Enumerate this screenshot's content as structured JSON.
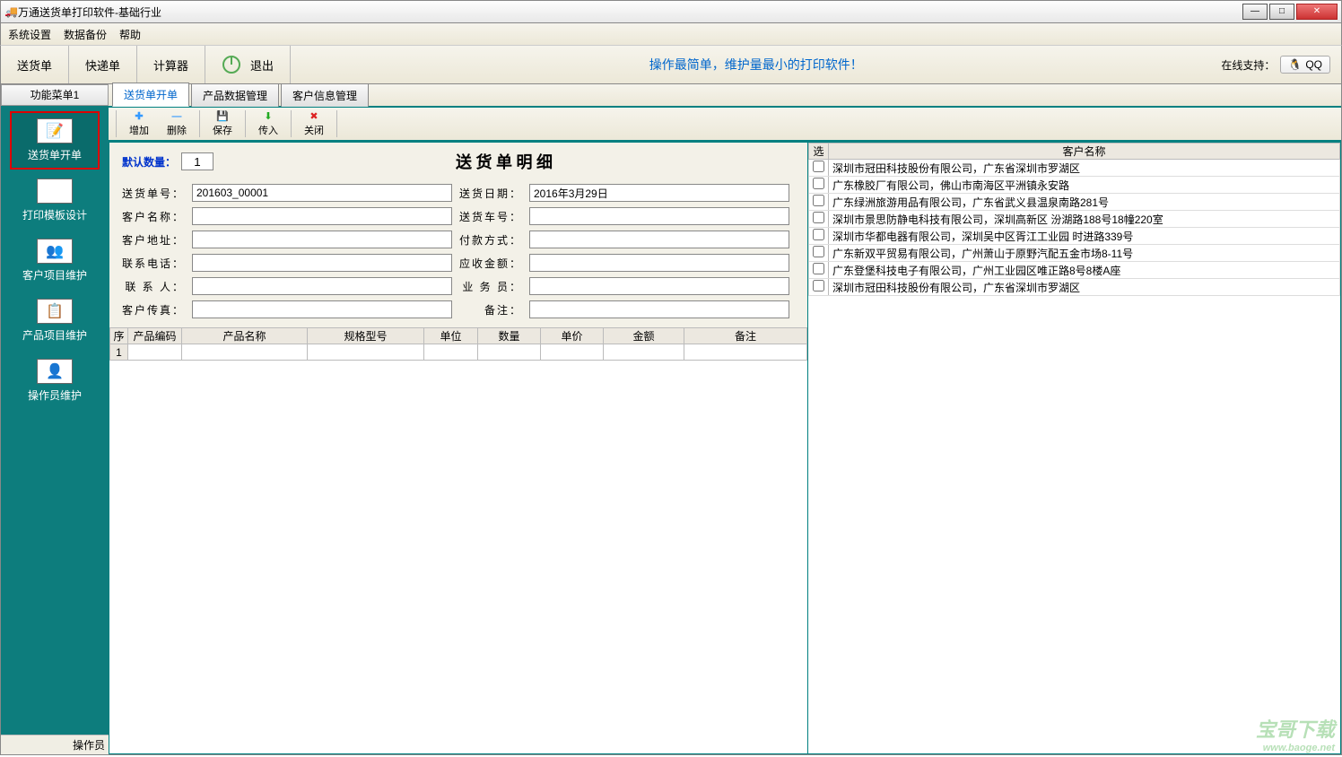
{
  "window": {
    "title": "万通送货单打印软件-基础行业"
  },
  "menubar": {
    "items": [
      "系统设置",
      "数据备份",
      "帮助"
    ]
  },
  "toolbar1": {
    "delivery": "送货单",
    "express": "快递单",
    "calc": "计算器",
    "exit": "退出",
    "slogan": "操作最简单，维护量最小的打印软件！",
    "support_label": "在线支持：",
    "qq": "QQ"
  },
  "sidebar": {
    "tab": "功能菜单1",
    "items": [
      {
        "label": "送货单开单",
        "icon": "📝"
      },
      {
        "label": "打印模板设计",
        "icon": "🖨"
      },
      {
        "label": "客户项目维护",
        "icon": "👥"
      },
      {
        "label": "产品项目维护",
        "icon": "📋"
      },
      {
        "label": "操作员维护",
        "icon": "👤"
      }
    ],
    "status": "操作员"
  },
  "tabs": {
    "t0": "送货单开单",
    "t1": "产品数据管理",
    "t2": "客户信息管理"
  },
  "toolbar2": {
    "add": "增加",
    "del": "删除",
    "save": "保存",
    "import": "传入",
    "close": "关闭"
  },
  "form": {
    "default_qty_label": "默认数量：",
    "default_qty": "1",
    "title": "送 货 单 明 细",
    "labels": {
      "order_no": "送货单号：",
      "date": "送货日期：",
      "cust_name": "客户名称：",
      "car_no": "送货车号：",
      "cust_addr": "客户地址：",
      "pay_method": "付款方式：",
      "phone": "联系电话：",
      "amount": "应收金额：",
      "contact": "联 系 人：",
      "staff": "业 务 员：",
      "fax": "客户传真：",
      "remark": "备注："
    },
    "values": {
      "order_no": "201603_00001",
      "date": "2016年3月29日"
    }
  },
  "grid": {
    "cols": {
      "seq": "序",
      "code": "产品编码",
      "name": "产品名称",
      "spec": "规格型号",
      "unit": "单位",
      "qty": "数量",
      "price": "单价",
      "amount": "金额",
      "remark": "备注"
    },
    "row1": "1"
  },
  "customers": {
    "header_sel": "选",
    "header_name": "客户名称",
    "rows": [
      "深圳市冠田科技股份有限公司，广东省深圳市罗湖区",
      "广东橡胶厂有限公司，佛山市南海区平洲镇永安路",
      "广东绿洲旅游用品有限公司，广东省武义县温泉南路281号",
      "深圳市景思防静电科技有限公司，深圳高新区 汾湖路188号18幢220室",
      "深圳市华都电器有限公司，深圳吴中区胥江工业园 时进路339号",
      "广东新双平贸易有限公司，广州萧山于原野汽配五金市场8-11号",
      "广东登堡科技电子有限公司，广州工业园区唯正路8号8楼A座",
      "深圳市冠田科技股份有限公司，广东省深圳市罗湖区"
    ]
  },
  "watermark": {
    "big": "宝哥下载",
    "small": "www.baoge.net"
  }
}
